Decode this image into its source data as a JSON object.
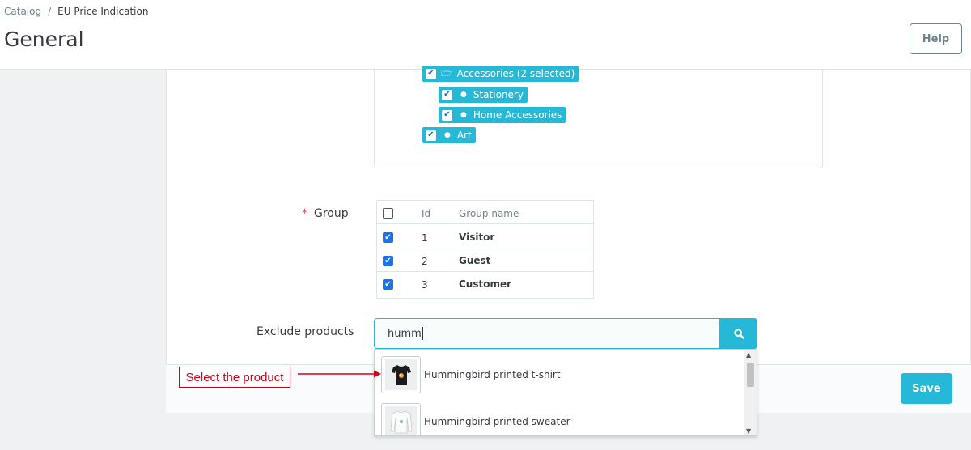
{
  "breadcrumb": {
    "parent": "Catalog",
    "separator": "/",
    "current": "EU Price Indication"
  },
  "page": {
    "title": "General"
  },
  "header": {
    "help_label": "Help"
  },
  "tree": {
    "items": [
      {
        "label": "Accessories (2 selected)",
        "checked": true
      },
      {
        "label": "Stationery",
        "checked": true
      },
      {
        "label": "Home Accessories",
        "checked": true
      },
      {
        "label": "Art",
        "checked": true
      }
    ]
  },
  "group": {
    "label": "Group",
    "required_mark": "*",
    "columns": {
      "id": "Id",
      "name": "Group name"
    },
    "rows": [
      {
        "id": "1",
        "name": "Visitor",
        "checked": true
      },
      {
        "id": "2",
        "name": "Guest",
        "checked": true
      },
      {
        "id": "3",
        "name": "Customer",
        "checked": true
      }
    ]
  },
  "exclude": {
    "label": "Exclude products",
    "search_value": "humm",
    "results": [
      {
        "name": "Hummingbird printed t-shirt"
      },
      {
        "name": "Hummingbird printed sweater"
      }
    ]
  },
  "footer": {
    "save_label": "Save"
  },
  "annotation": {
    "text": "Select the product"
  },
  "colors": {
    "accent": "#25b9d7",
    "annotation": "#d0021b",
    "required": "#e44b4b"
  }
}
